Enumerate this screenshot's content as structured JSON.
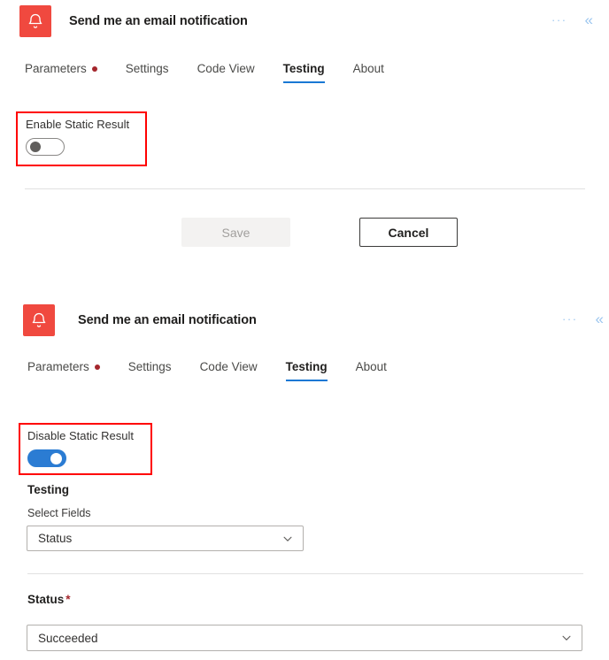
{
  "panels": [
    {
      "header": {
        "icon_name": "bell-icon",
        "icon_bg": "#f0493f",
        "title": "Send me an email notification",
        "more_label": "···",
        "collapse_label": "«"
      },
      "tabs": [
        {
          "label": "Parameters",
          "active": false,
          "has_badge": true
        },
        {
          "label": "Settings",
          "active": false,
          "has_badge": false
        },
        {
          "label": "Code View",
          "active": false,
          "has_badge": false
        },
        {
          "label": "Testing",
          "active": true,
          "has_badge": false
        },
        {
          "label": "About",
          "active": false,
          "has_badge": false
        }
      ],
      "static_result": {
        "label": "Enable Static Result",
        "state": "off"
      },
      "buttons": {
        "save_label": "Save",
        "save_disabled": true,
        "cancel_label": "Cancel"
      }
    },
    {
      "header": {
        "icon_name": "bell-icon",
        "icon_bg": "#f0493f",
        "title": "Send me an email notification",
        "more_label": "···",
        "collapse_label": "«"
      },
      "tabs": [
        {
          "label": "Parameters",
          "active": false,
          "has_badge": true
        },
        {
          "label": "Settings",
          "active": false,
          "has_badge": false
        },
        {
          "label": "Code View",
          "active": false,
          "has_badge": false
        },
        {
          "label": "Testing",
          "active": true,
          "has_badge": false
        },
        {
          "label": "About",
          "active": false,
          "has_badge": false
        }
      ],
      "static_result": {
        "label": "Disable Static Result",
        "state": "on"
      },
      "testing_section": {
        "heading": "Testing",
        "select_fields_label": "Select Fields",
        "select_fields_value": "Status",
        "status_label": "Status",
        "status_required_marker": "*",
        "status_value": "Succeeded"
      }
    }
  ],
  "colors": {
    "accent_blue": "#1978d4",
    "toggle_on": "#2b7cd3",
    "brand_red": "#f0493f",
    "badge_red": "#a4262c",
    "highlight_border": "#ff0000"
  }
}
